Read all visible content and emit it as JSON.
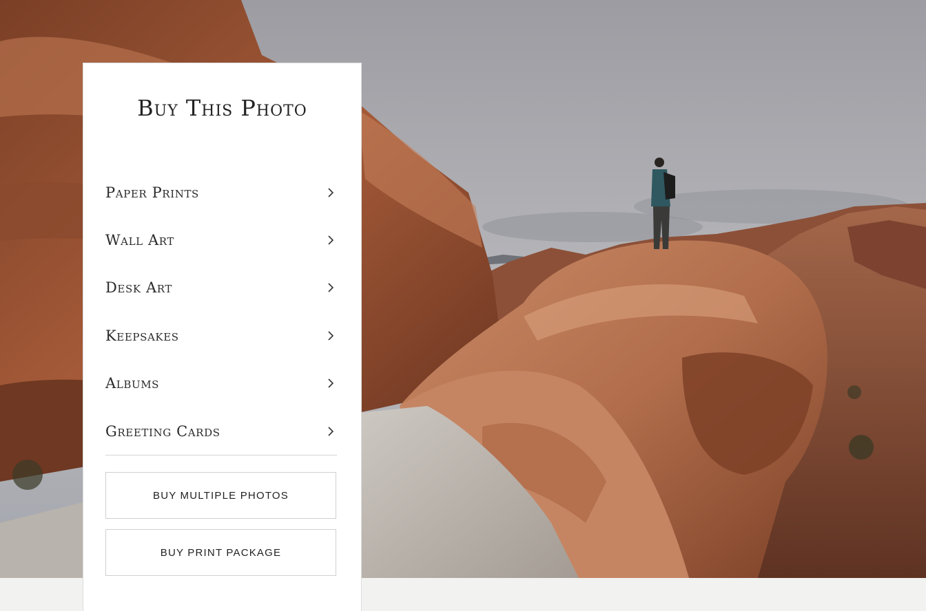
{
  "panel": {
    "title": "Buy This Photo",
    "menu_items": [
      {
        "label": "Paper Prints",
        "icon": "chevron-right-icon"
      },
      {
        "label": "Wall Art",
        "icon": "chevron-right-icon"
      },
      {
        "label": "Desk Art",
        "icon": "chevron-right-icon"
      },
      {
        "label": "Keepsakes",
        "icon": "chevron-right-icon"
      },
      {
        "label": "Albums",
        "icon": "chevron-right-icon"
      },
      {
        "label": "Greeting Cards",
        "icon": "chevron-right-icon"
      }
    ],
    "buttons": {
      "multiple": "BUY MULTIPLE PHOTOS",
      "package": "BUY PRINT PACKAGE"
    }
  },
  "photo": {
    "subject": "hiker standing on red sandstone rock under cloudy sky"
  },
  "colors": {
    "sky": "#a9a9ae",
    "rock": "#b0694a",
    "panel_bg": "#ffffff",
    "page_bg": "#f2f2f0"
  }
}
